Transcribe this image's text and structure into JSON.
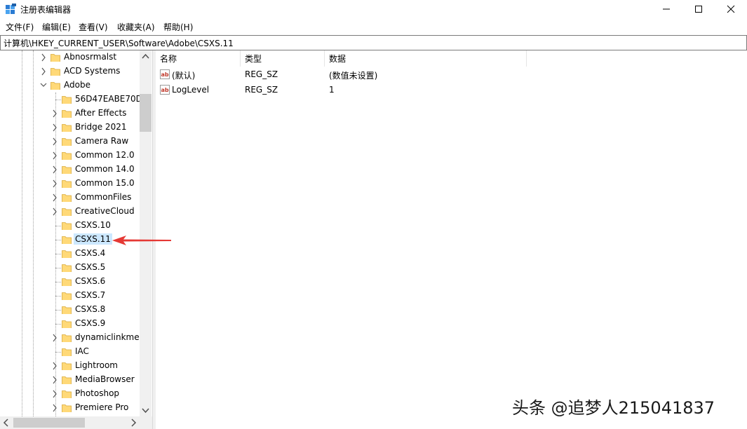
{
  "window": {
    "title": "注册表编辑器",
    "controls": [
      "minimize",
      "maximize",
      "close"
    ]
  },
  "menu": [
    "文件(F)",
    "编辑(E)",
    "查看(V)",
    "收藏夹(A)",
    "帮助(H)"
  ],
  "address": "计算机\\HKEY_CURRENT_USER\\Software\\Adobe\\CSXS.11",
  "tree": {
    "items": [
      {
        "label": "Abnosrmalst",
        "level": 1,
        "expander": "collapsed"
      },
      {
        "label": "ACD Systems",
        "level": 1,
        "expander": "collapsed"
      },
      {
        "label": "Adobe",
        "level": 1,
        "expander": "expanded"
      },
      {
        "label": "56D47EABE70D",
        "level": 2,
        "expander": "none"
      },
      {
        "label": "After Effects",
        "level": 2,
        "expander": "collapsed"
      },
      {
        "label": "Bridge 2021",
        "level": 2,
        "expander": "collapsed"
      },
      {
        "label": "Camera Raw",
        "level": 2,
        "expander": "collapsed"
      },
      {
        "label": "Common 12.0",
        "level": 2,
        "expander": "collapsed"
      },
      {
        "label": "Common 14.0",
        "level": 2,
        "expander": "collapsed"
      },
      {
        "label": "Common 15.0",
        "level": 2,
        "expander": "collapsed"
      },
      {
        "label": "CommonFiles",
        "level": 2,
        "expander": "collapsed"
      },
      {
        "label": "CreativeCloud",
        "level": 2,
        "expander": "collapsed"
      },
      {
        "label": "CSXS.10",
        "level": 2,
        "expander": "none"
      },
      {
        "label": "CSXS.11",
        "level": 2,
        "expander": "none",
        "selected": true
      },
      {
        "label": "CSXS.4",
        "level": 2,
        "expander": "none"
      },
      {
        "label": "CSXS.5",
        "level": 2,
        "expander": "none"
      },
      {
        "label": "CSXS.6",
        "level": 2,
        "expander": "none"
      },
      {
        "label": "CSXS.7",
        "level": 2,
        "expander": "none"
      },
      {
        "label": "CSXS.8",
        "level": 2,
        "expander": "none"
      },
      {
        "label": "CSXS.9",
        "level": 2,
        "expander": "none"
      },
      {
        "label": "dynamiclinkmec",
        "level": 2,
        "expander": "collapsed"
      },
      {
        "label": "IAC",
        "level": 2,
        "expander": "none"
      },
      {
        "label": "Lightroom",
        "level": 2,
        "expander": "collapsed"
      },
      {
        "label": "MediaBrowser",
        "level": 2,
        "expander": "collapsed"
      },
      {
        "label": "Photoshop",
        "level": 2,
        "expander": "collapsed"
      },
      {
        "label": "Premiere Pro",
        "level": 2,
        "expander": "collapsed"
      }
    ]
  },
  "list": {
    "columns": [
      "名称",
      "类型",
      "数据"
    ],
    "rows": [
      {
        "name": "(默认)",
        "type": "REG_SZ",
        "data": "(数值未设置)"
      },
      {
        "name": "LogLevel",
        "type": "REG_SZ",
        "data": "1"
      }
    ]
  },
  "annotation": {
    "color": "#e53935",
    "points_to": "CSXS.11"
  },
  "watermark": "头条 @追梦人215041837",
  "colors": {
    "selection": "#cce8ff",
    "folder": "#ffd978",
    "folder_edge": "#d9a93a",
    "reg_sz_icon": "#c0392b"
  }
}
